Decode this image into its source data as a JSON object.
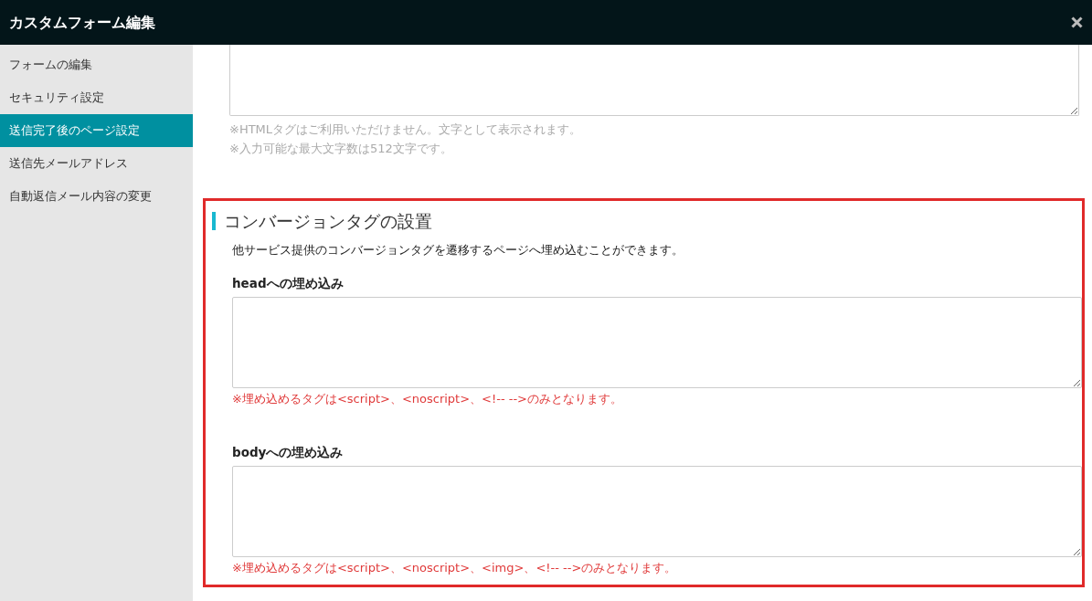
{
  "window": {
    "title": "カスタムフォーム編集"
  },
  "sidebar": {
    "items": [
      {
        "label": "フォームの編集",
        "selected": false
      },
      {
        "label": "セキュリティ設定",
        "selected": false
      },
      {
        "label": "送信完了後のページ設定",
        "selected": true
      },
      {
        "label": "送信先メールアドレス",
        "selected": false
      },
      {
        "label": "自動返信メール内容の変更",
        "selected": false
      }
    ]
  },
  "top_field": {
    "notes": [
      "※HTMLタグはご利用いただけません。文字として表示されます。",
      "※入力可能な最大文字数は512文字です。"
    ]
  },
  "conversion_section": {
    "title": "コンバージョンタグの設置",
    "description": "他サービス提供のコンバージョンタグを遷移するページへ埋め込むことができます。",
    "fields": [
      {
        "label": "headへの埋め込み",
        "note": "※埋め込めるタグは<script>、<noscript>、<!-- -->のみとなります。"
      },
      {
        "label": "bodyへの埋め込み",
        "note": "※埋め込めるタグは<script>、<noscript>、<img>、<!-- -->のみとなります。"
      }
    ]
  }
}
